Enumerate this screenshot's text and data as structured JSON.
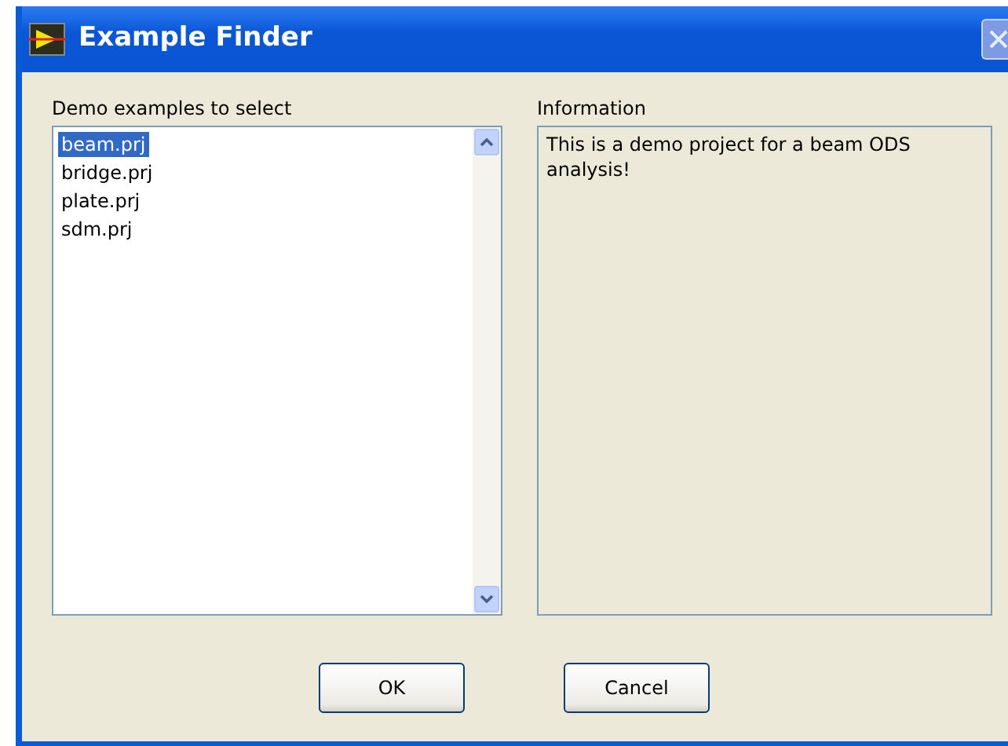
{
  "window": {
    "title": "Example Finder"
  },
  "examples": {
    "label": "Demo examples to select",
    "items": [
      {
        "text": "beam.prj",
        "selected": true
      },
      {
        "text": "bridge.prj",
        "selected": false
      },
      {
        "text": "plate.prj",
        "selected": false
      },
      {
        "text": "sdm.prj",
        "selected": false
      }
    ]
  },
  "information": {
    "label": "Information",
    "text": "This is a demo project for a beam ODS analysis!"
  },
  "buttons": [
    {
      "label": "OK"
    },
    {
      "label": "Cancel"
    }
  ]
}
